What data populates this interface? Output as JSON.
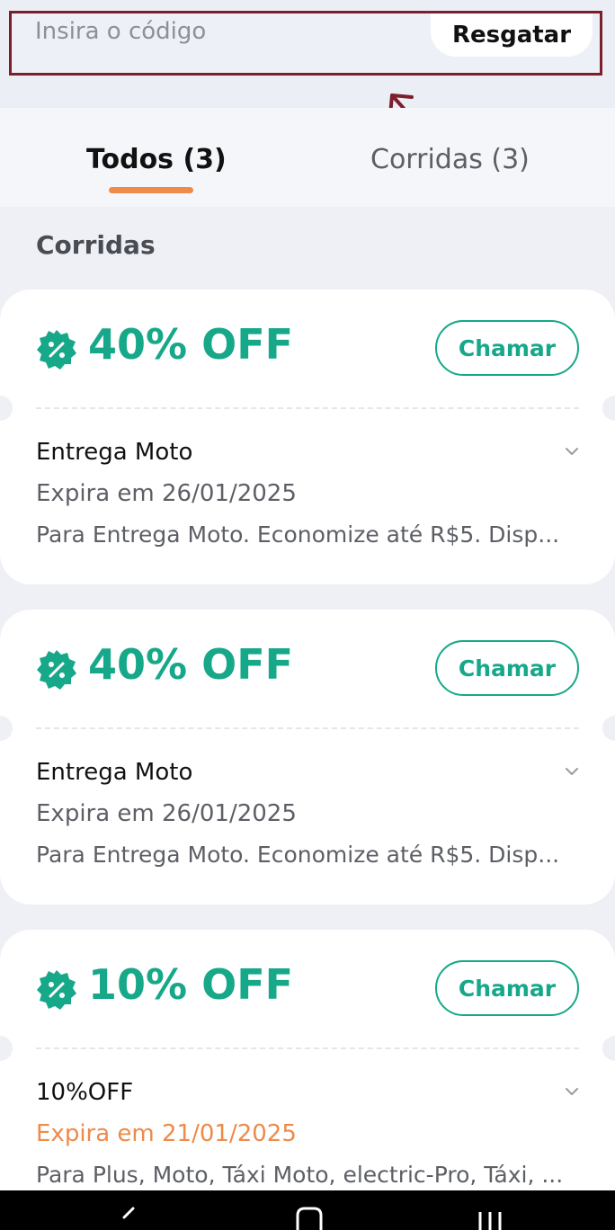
{
  "redeem": {
    "placeholder": "Insira o código",
    "button_label": "Resgatar",
    "highlight_color": "#7a1f2b"
  },
  "tabs": [
    {
      "label": "Todos (3)",
      "selected": true
    },
    {
      "label": "Corridas (3)",
      "selected": false
    }
  ],
  "section_title": "Corridas",
  "colors": {
    "accent": "#16a889",
    "tab_indicator": "#f08a4b",
    "urgent": "#ee8a4a"
  },
  "coupons": [
    {
      "discount": "40% OFF",
      "action_label": "Chamar",
      "name": "Entrega Moto",
      "expiry": "Expira em 26/01/2025",
      "expiry_urgent": false,
      "description": "Para Entrega Moto. Economize até R$5. Disp..."
    },
    {
      "discount": "40% OFF",
      "action_label": "Chamar",
      "name": "Entrega Moto",
      "expiry": "Expira em 26/01/2025",
      "expiry_urgent": false,
      "description": "Para Entrega Moto. Economize até R$5. Disp..."
    },
    {
      "discount": "10% OFF",
      "action_label": "Chamar",
      "name": "10%OFF",
      "expiry": "Expira em 21/01/2025",
      "expiry_urgent": true,
      "description": "Para Plus, Moto, Táxi Moto, electric-Pro, Táxi, ..."
    }
  ],
  "icons": {
    "coupon_badge": "percent-badge-icon",
    "expand": "chevron-down-icon",
    "annotation": "arrow-up-icon",
    "nav": [
      "back-icon",
      "home-icon",
      "recents-icon"
    ]
  }
}
